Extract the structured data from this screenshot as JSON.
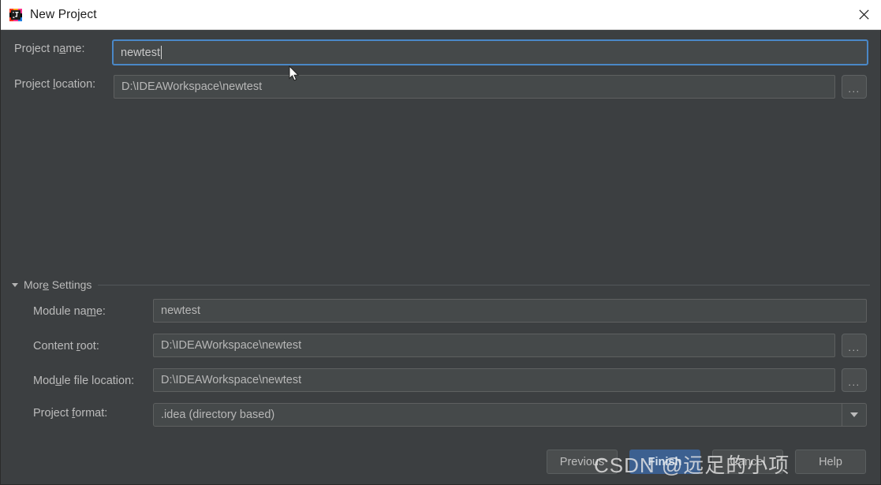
{
  "window": {
    "title": "New Project",
    "icon": "intellij-idea-icon",
    "close_label": "close-icon",
    "background": "#3c3f41",
    "titlebar_background": "#ffffff"
  },
  "form": {
    "project_name": {
      "label_prefix": "Project n",
      "label_mnemonic": "a",
      "label_suffix": "me:",
      "value": "newtest",
      "focused": true
    },
    "project_location": {
      "label_prefix": "Project ",
      "label_mnemonic": "l",
      "label_suffix": "ocation:",
      "value": "D:\\IDEAWorkspace\\newtest",
      "browse_label": "..."
    }
  },
  "more_settings": {
    "label_prefix": "Mor",
    "label_mnemonic": "e",
    "label_suffix": " Settings",
    "expanded": true,
    "module_name": {
      "label_prefix": "Module na",
      "label_mnemonic": "m",
      "label_suffix": "e:",
      "value": "newtest"
    },
    "content_root": {
      "label_prefix": "Content ",
      "label_mnemonic": "r",
      "label_suffix": "oot:",
      "value": "D:\\IDEAWorkspace\\newtest",
      "browse_label": "..."
    },
    "module_file_location": {
      "label_prefix": "Mod",
      "label_mnemonic": "u",
      "label_suffix": "le file location:",
      "value": "D:\\IDEAWorkspace\\newtest",
      "browse_label": "..."
    },
    "project_format": {
      "label_prefix": "Project ",
      "label_mnemonic": "f",
      "label_suffix": "ormat:",
      "value": ".idea (directory based)"
    }
  },
  "buttons": {
    "previous": "Previous",
    "finish": "Finish",
    "cancel": "Cancel",
    "help": "Help",
    "primary_color": "#3c6090"
  },
  "watermark": {
    "text": "CSDN @远足的小项"
  }
}
